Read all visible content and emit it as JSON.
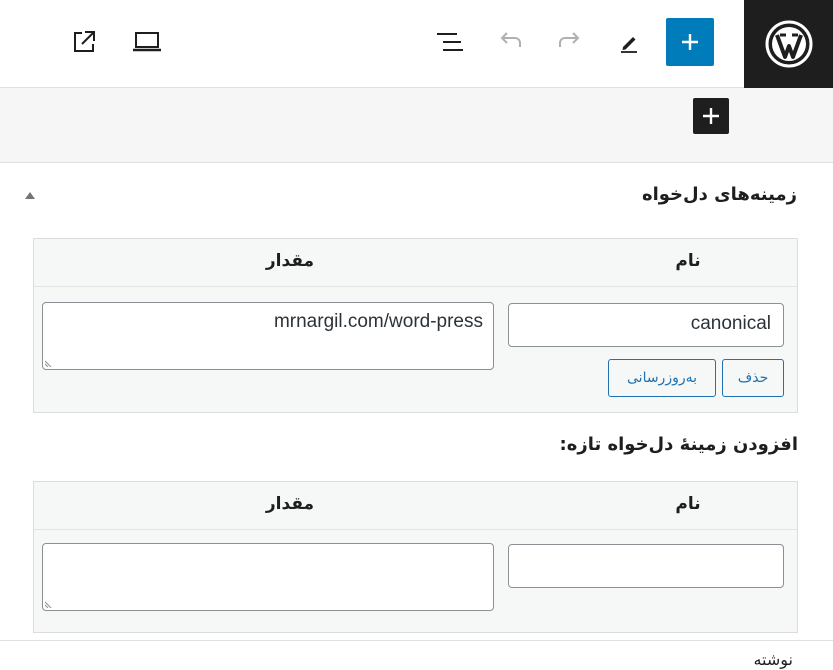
{
  "toolbar": {
    "logo_icon": "wordpress-logo",
    "add_block_icon": "plus-icon",
    "edit_icon": "pencil-icon",
    "redo_icon": "redo-icon",
    "undo_icon": "undo-icon",
    "list_view_icon": "list-view-icon",
    "preview_icon": "laptop-icon",
    "view_post_icon": "external-link-icon",
    "accent_color": "#007cba"
  },
  "canvas": {
    "inserter_icon": "plus-icon"
  },
  "custom_fields": {
    "title": "زمینه‌های دل‌خواه",
    "name_header": "نام",
    "value_header": "مقدار",
    "rows": [
      {
        "name": "canonical",
        "value": "mrnargil.com/word-press",
        "delete_label": "حذف",
        "update_label": "به‌روزرسانی"
      }
    ]
  },
  "add_new": {
    "title": "افزودن زمینهٔ دل‌خواه تازه:",
    "name_header": "نام",
    "value_header": "مقدار",
    "name_value": "",
    "value_value": ""
  },
  "footer": {
    "label": "نوشته"
  }
}
